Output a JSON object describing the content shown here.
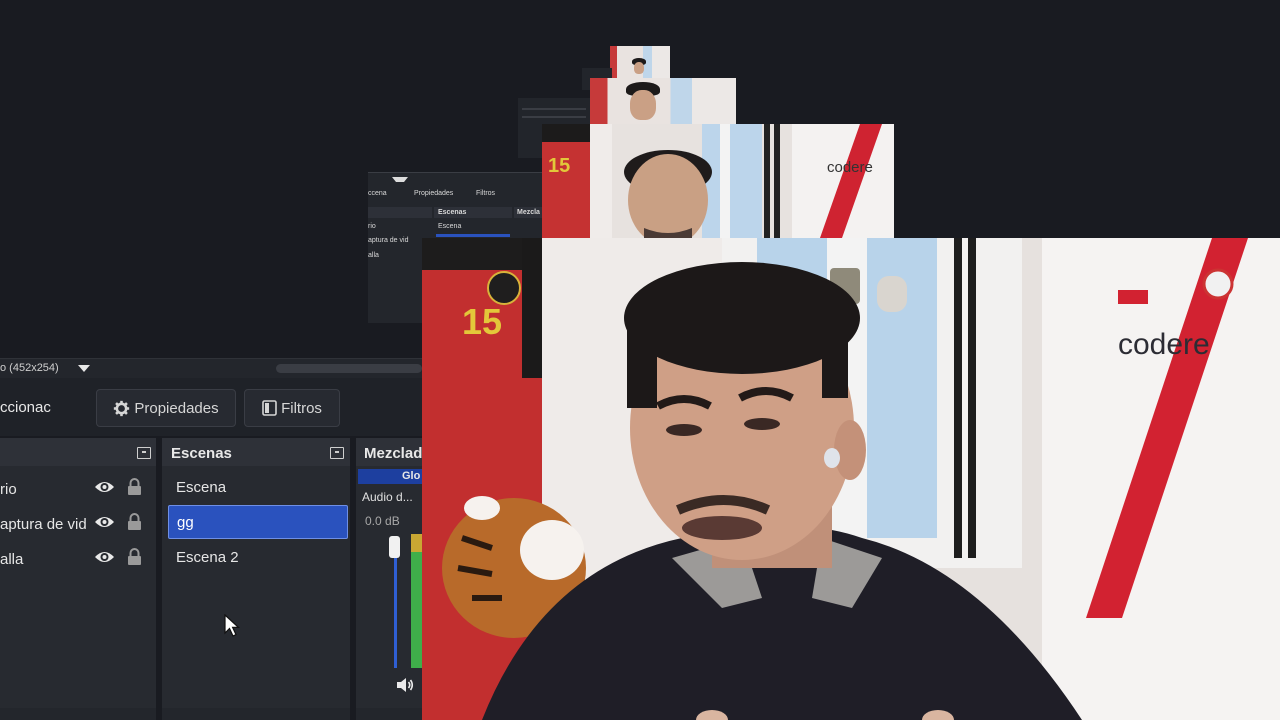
{
  "preview": {
    "resolution_text": "o (452x254)"
  },
  "mini_panel": {
    "tab1": "ccena",
    "tab2": "Propiedades",
    "tab3": "Filtros",
    "scenes_title": "Escenas",
    "mixer_title": "Mezcla",
    "scene_first": "Escena",
    "sources": [
      "rio",
      "aptura de vid",
      "alla"
    ]
  },
  "toolbar": {
    "selection_label": "ccionac",
    "properties_label": "Propiedades",
    "filters_label": "Filtros"
  },
  "sources": {
    "items": [
      {
        "label": "rio"
      },
      {
        "label": "aptura de vid"
      },
      {
        "label": "alla"
      }
    ]
  },
  "scenes": {
    "title": "Escenas",
    "items": [
      {
        "label": "Escena",
        "selected": false
      },
      {
        "label": "gg",
        "selected": true
      },
      {
        "label": "Escena 2",
        "selected": false
      }
    ]
  },
  "mixer": {
    "title": "Mezclad",
    "global_tab": "Glo",
    "channel_label": "Audio d...",
    "level": "0.0 dB"
  },
  "colors": {
    "selected_scene": "#2a52be",
    "meter_green": "#3fae4a",
    "meter_yellow": "#c9a733"
  }
}
